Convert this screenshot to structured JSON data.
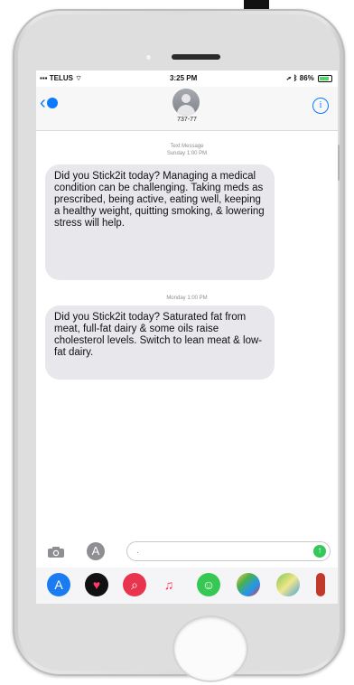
{
  "status_bar": {
    "carrier": "TELUS",
    "time": "3:25 PM",
    "battery": "86%"
  },
  "header": {
    "contact": "737-77",
    "info": "i"
  },
  "thread": [
    {
      "meta_line1": "Text Message",
      "meta_line2": "Sunday 1:00 PM",
      "text": "Did you Stick2it today? Managing a medical condition can be challenging. Taking meds as prescribed, being active, eating well, keeping a healthy weight, quitting smoking, & lowering stress will help."
    },
    {
      "meta_line1": "Monday 1:00 PM",
      "text": "Did you Stick2it today? Saturated fat from meat, full-fat dairy & some oils raise cholesterol levels. Switch to lean meat & low-fat dairy."
    }
  ],
  "composer": {
    "input_value": ".",
    "send_symbol": "↑"
  },
  "icons": {
    "tray": [
      "app-store-icon",
      "digital-touch-icon",
      "web-images-icon",
      "music-icon",
      "memoji-icon",
      "photos-icon",
      "maps-icon"
    ]
  },
  "colors": {
    "accent": "#0a7aff",
    "incoming_bubble": "#e7e7ec",
    "send": "#34c759"
  }
}
